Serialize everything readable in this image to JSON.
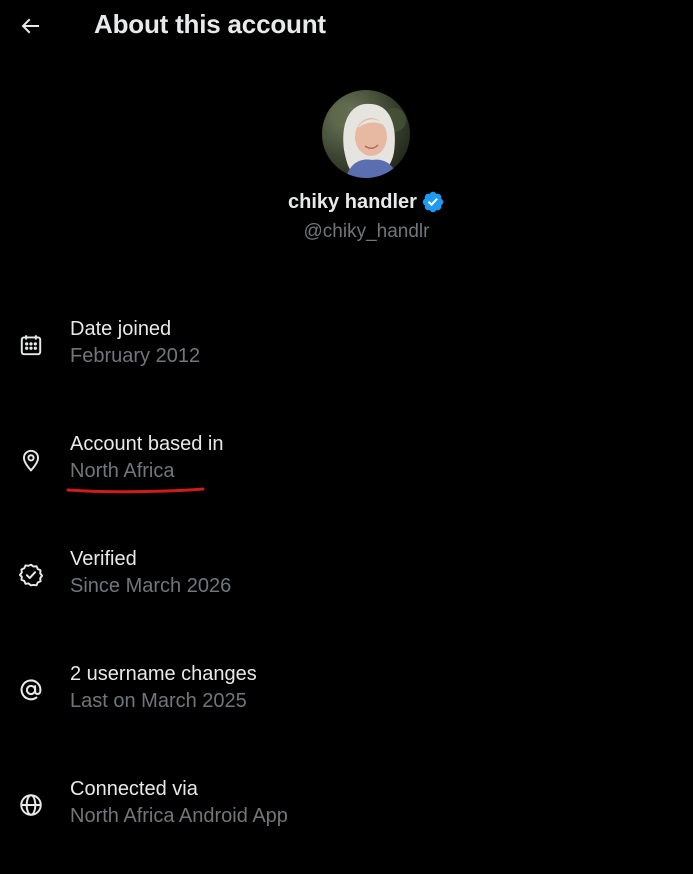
{
  "header": {
    "title": "About this account",
    "back_icon": "arrow-left-icon"
  },
  "profile": {
    "display_name": "chiky handler",
    "handle": "@chiky_handlr",
    "verified_badge_color": "#1d9bf0"
  },
  "details": [
    {
      "icon": "calendar-icon",
      "title": "Date joined",
      "value": "February 2012"
    },
    {
      "icon": "location-pin-icon",
      "title": "Account based in",
      "value": "North Africa"
    },
    {
      "icon": "verified-check-icon",
      "title": "Verified",
      "value": "Since March 2026"
    },
    {
      "icon": "at-sign-icon",
      "title": "2 username changes",
      "value": "Last on March 2025"
    },
    {
      "icon": "globe-icon",
      "title": "Connected via",
      "value": "North Africa Android App"
    }
  ],
  "colors": {
    "background": "#000000",
    "primary_text": "#e7e9ea",
    "secondary_text": "#71767b",
    "annotation_underline": "#d11a1a"
  }
}
